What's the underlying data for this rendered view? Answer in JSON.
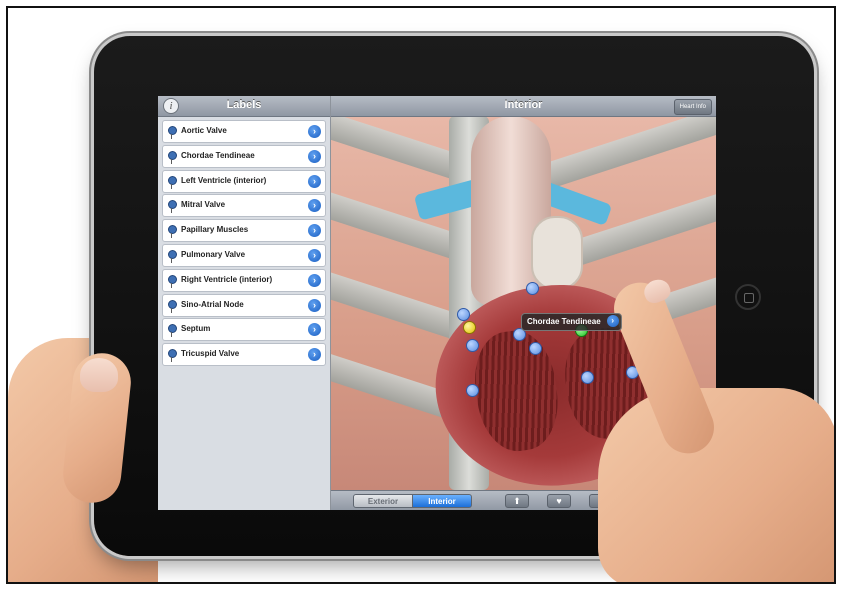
{
  "sidebar": {
    "info_label": "i",
    "title": "Labels",
    "items": [
      {
        "label": "Aortic Valve"
      },
      {
        "label": "Chordae Tendineae"
      },
      {
        "label": "Left Ventricle (interior)"
      },
      {
        "label": "Mitral Valve"
      },
      {
        "label": "Papillary Muscles"
      },
      {
        "label": "Pulmonary Valve"
      },
      {
        "label": "Right Ventricle (interior)"
      },
      {
        "label": "Sino-Atrial Node"
      },
      {
        "label": "Septum"
      },
      {
        "label": "Tricuspid Valve"
      }
    ],
    "disclosure_glyph": "›"
  },
  "main": {
    "title": "Interior",
    "heart_info_button": "Heart Info",
    "callout_label": "Chordae Tendineae"
  },
  "toolbar": {
    "exterior": "Exterior",
    "interior": "Interior",
    "selected": "Interior"
  },
  "colors": {
    "accent_blue": "#1c6fd8",
    "header_gray": "#8f97a3",
    "marker_blue": "#5b8ee0",
    "marker_yellow": "#e0c200",
    "marker_green": "#1fbf1f"
  }
}
